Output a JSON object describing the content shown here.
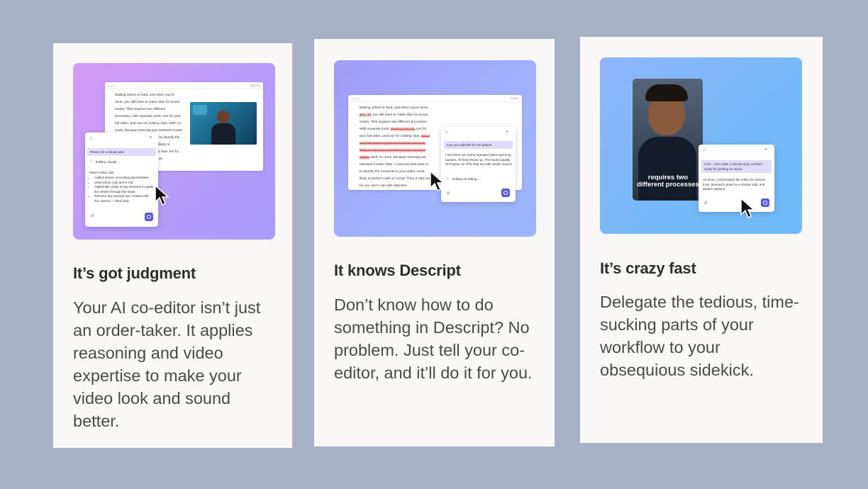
{
  "cards": [
    {
      "title": "It’s got judgment",
      "body": "Your AI co-editor isn’t just an order-taker. It applies reasoning and video expertise to make your video look and sound better.",
      "illustration": {
        "window_action": "Export",
        "transcript": "Making videos is hard, and when you're done, you still have to make clips for social media. That requires two different processes, with separate tools, one for your full video, and one for making clips. Well, no more, because Descript just released Create Clips. A new tool that uses AI to identify the moments in your video most likely to perform well on social. Then it clips 'em for you and it can edit your clips as",
        "prompt": "Please do a visual pass",
        "status": "Editing visuals...",
        "summary_title": "Here's what I did:",
        "summary_items": [
          "Added screen recording placeholders.",
          "Used Zoom cuts and b-roll.",
          "Added title cards at key sections to guide the viewer through the steps.",
          "Remove any strange eye contact with the camera - I fixed that."
        ]
      }
    },
    {
      "title": "It knows Descript",
      "body": "Don’t know how to do something in Descript? No problem. Just tell your co-editor, and it’ll do it for you.",
      "illustration": {
        "window_action": "Done",
        "prompt": "Can you edit this for me please",
        "reply": "I see there are some repeated takes and long pauses, I'll clean those up. The sound quality isn't great, so I'll fix that too with Studio Sound.",
        "status": "Editing recording..."
      }
    },
    {
      "title": "It’s crazy fast",
      "body": "Delegate the tedious, time-sucking parts of your workflow to your obsequious sidekick.",
      "illustration": {
        "caption": "requires two different processes",
        "prompt": "Cool - now make a minute long cut that's ready for posting on social",
        "reply": "All done, I reformatted the video for vertical 9:16, trimmed it down to a shorter edit, and added captions."
      }
    }
  ],
  "colors": {
    "background": "#a6b1c5",
    "card": "#f9f8f6",
    "accent": "#5b57e0"
  }
}
